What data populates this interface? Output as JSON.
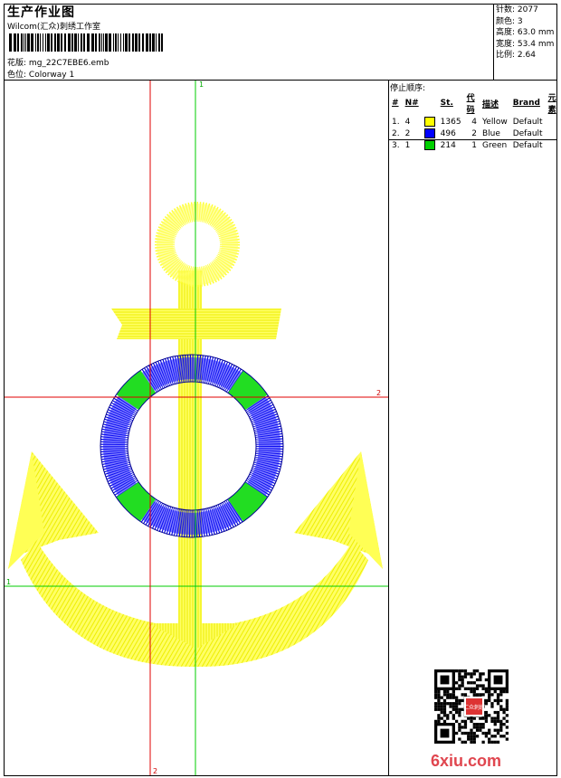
{
  "header": {
    "title": "生产作业图",
    "subtitle": "Wilcom(汇众)刺绣工作室",
    "design_label": "花版:",
    "design_value": "mg_22C7EBE6.emb",
    "colorway_label": "色位:",
    "colorway_value": "Colorway 1"
  },
  "stats": [
    {
      "label": "针数:",
      "value": "2077"
    },
    {
      "label": "颜色:",
      "value": "3"
    },
    {
      "label": "高度:",
      "value": "63.0 mm"
    },
    {
      "label": "宽度:",
      "value": "53.4 mm"
    },
    {
      "label": "比例:",
      "value": "2.64"
    }
  ],
  "stop_sequence": {
    "title": "停止顺序:",
    "columns": [
      "#",
      "N#",
      "St.",
      "代码",
      "描述",
      "Brand",
      "元素"
    ],
    "rows": [
      {
        "idx": "1.",
        "n": "4",
        "color": "#ffff00",
        "st": "1365",
        "code": "4",
        "desc": "Yellow",
        "brand": "Default"
      },
      {
        "idx": "2.",
        "n": "2",
        "color": "#0000ff",
        "st": "496",
        "code": "2",
        "desc": "Blue",
        "brand": "Default"
      },
      {
        "idx": "3.",
        "n": "1",
        "color": "#00d000",
        "st": "214",
        "code": "1",
        "desc": "Green",
        "brand": "Default"
      }
    ]
  },
  "guides": {
    "top_green": "1",
    "right_red": "2",
    "left_green": "1",
    "bottom_red": "2"
  },
  "colors": {
    "yellow": "#ffff00",
    "blue": "#0000e0",
    "green": "#22dd22",
    "guide_red": "#e00000",
    "guide_green": "#00cc00"
  },
  "watermark": "6xiu.com",
  "qr_stamp": "汇众刺绣"
}
